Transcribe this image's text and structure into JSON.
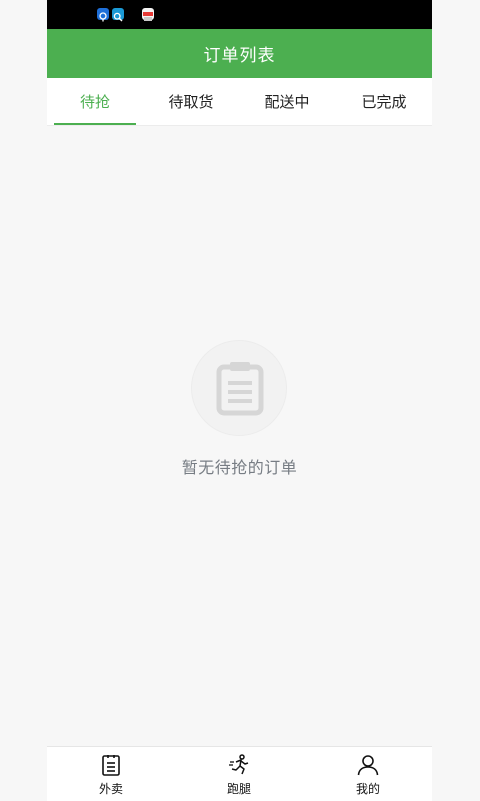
{
  "header": {
    "title": "订单列表"
  },
  "tabs": [
    {
      "label": "待抢",
      "active": true
    },
    {
      "label": "待取货",
      "active": false
    },
    {
      "label": "配送中",
      "active": false
    },
    {
      "label": "已完成",
      "active": false
    }
  ],
  "empty_state": {
    "icon": "clipboard-icon",
    "message": "暂无待抢的订单"
  },
  "bottom_nav": [
    {
      "label": "外卖",
      "icon": "order-list-icon"
    },
    {
      "label": "跑腿",
      "icon": "runner-icon"
    },
    {
      "label": "我的",
      "icon": "user-icon"
    }
  ],
  "colors": {
    "accent": "#4caf50",
    "status_bar": "#000000",
    "background": "#f7f7f7"
  }
}
